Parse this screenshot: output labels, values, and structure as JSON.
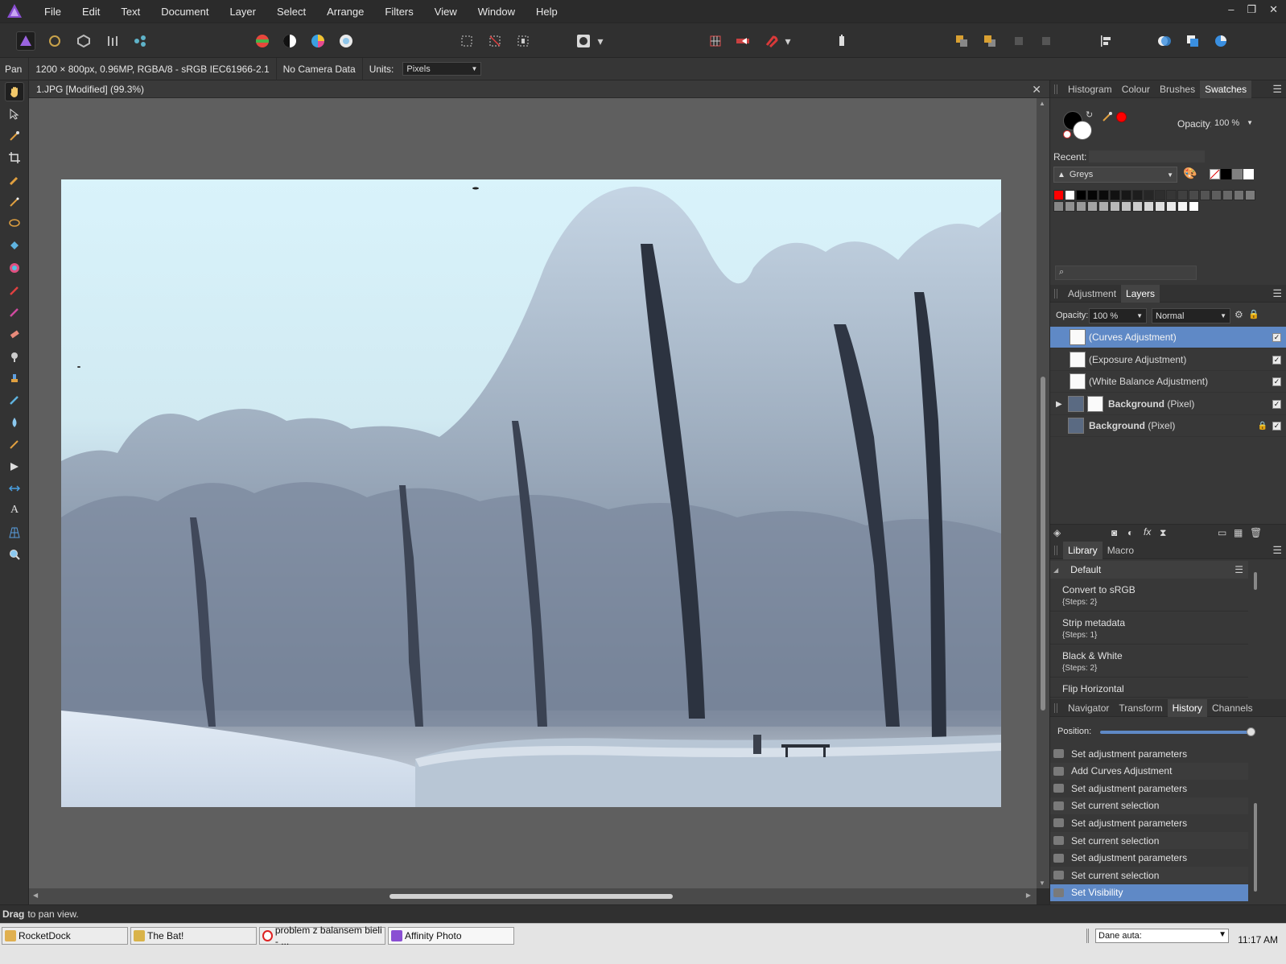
{
  "menubar": {
    "items": [
      "File",
      "Edit",
      "Text",
      "Document",
      "Layer",
      "Select",
      "Arrange",
      "Filters",
      "View",
      "Window",
      "Help"
    ],
    "controls": {
      "minimize": "–",
      "restore": "❐",
      "close": "✕"
    }
  },
  "context": {
    "tool_name": "Pan",
    "doc_info": "1200 × 800px, 0.96MP, RGBA/8 - sRGB IEC61966-2.1",
    "camera": "No Camera Data",
    "units_label": "Units:",
    "units_value": "Pixels"
  },
  "document": {
    "tab_title": "1.JPG [Modified] (99.3%)",
    "close": "✕"
  },
  "swatches_panel": {
    "tabs": [
      "Histogram",
      "Colour",
      "Brushes",
      "Swatches"
    ],
    "active_tab": "Swatches",
    "opacity_label": "Opacity:",
    "opacity_value": "100 %",
    "recent_label": "Recent:",
    "palette_name": "Greys"
  },
  "layers_panel": {
    "tabs": [
      "Adjustment",
      "Layers"
    ],
    "active_tab": "Layers",
    "opacity_label": "Opacity:",
    "opacity_value": "100 %",
    "blend_mode": "Normal",
    "layers": [
      {
        "name": "(Curves Adjustment)",
        "type": "",
        "selected": true,
        "visible": true
      },
      {
        "name": "(Exposure Adjustment)",
        "type": "",
        "selected": false,
        "visible": true
      },
      {
        "name": "(White Balance Adjustment)",
        "type": "",
        "selected": false,
        "visible": true
      },
      {
        "name": "Background",
        "type": "(Pixel)",
        "selected": false,
        "visible": true
      },
      {
        "name": "Background",
        "type": "(Pixel)",
        "selected": false,
        "visible": true
      }
    ]
  },
  "library_panel": {
    "tabs": [
      "Library",
      "Macro"
    ],
    "active_tab": "Library",
    "category": "Default",
    "items": [
      {
        "name": "Convert to sRGB",
        "steps": "{Steps: 2}"
      },
      {
        "name": "Strip metadata",
        "steps": "{Steps: 1}"
      },
      {
        "name": "Black & White",
        "steps": "{Steps: 2}"
      },
      {
        "name": "Flip Horizontal",
        "steps": ""
      }
    ]
  },
  "history_panel": {
    "tabs": [
      "Navigator",
      "Transform",
      "History",
      "Channels"
    ],
    "active_tab": "History",
    "position_label": "Position:",
    "position_value": 1.0,
    "entries": [
      "Set adjustment parameters",
      "Add Curves Adjustment",
      "Set adjustment parameters",
      "Set current selection",
      "Set adjustment parameters",
      "Set current selection",
      "Set adjustment parameters",
      "Set current selection",
      "Set Visibility"
    ],
    "selected_index": 8
  },
  "status": {
    "bold": "Drag",
    "text": "to pan view."
  },
  "taskbar": {
    "tasks": [
      "RocketDock",
      "The Bat!",
      "problem z balansem bieli - ...",
      "Affinity Photo"
    ],
    "tray_dropdown": "Dane auta:",
    "clock": "11:17 AM"
  },
  "colors": {
    "accent": "#5f89c6",
    "primary_color": "#000000",
    "secondary_color": "#ffffff",
    "recent_swatch": "#ff0000"
  }
}
